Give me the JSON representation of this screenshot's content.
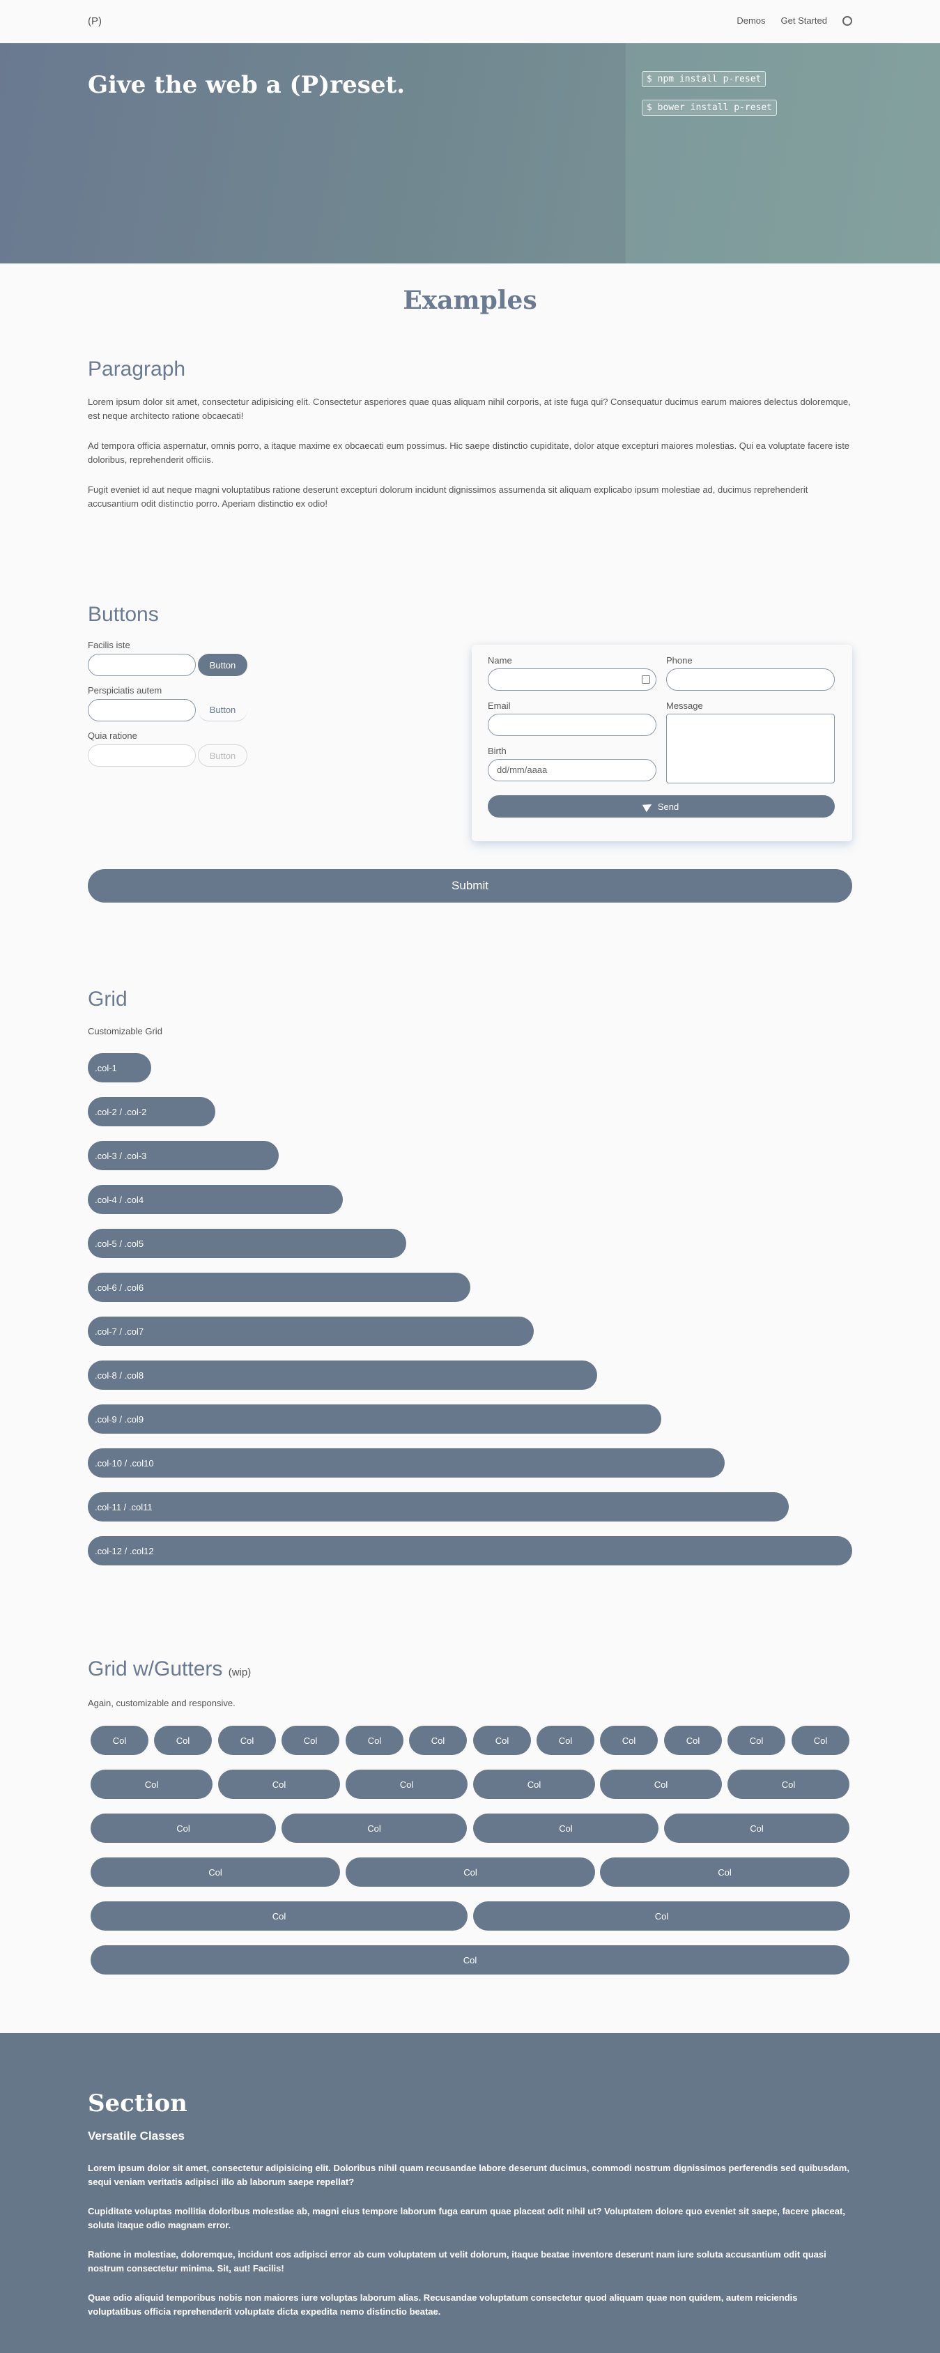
{
  "nav": {
    "logo": "(P)",
    "links": [
      "Demos",
      "Get Started"
    ],
    "github_icon": "github-icon"
  },
  "hero": {
    "title": "Give the web a (P)reset.",
    "commands": [
      "$ npm install p-reset",
      "$ bower install p-reset"
    ]
  },
  "examples_title": "Examples",
  "paragraph": {
    "heading": "Paragraph",
    "texts": [
      "Lorem ipsum dolor sit amet, consectetur adipisicing elit. Consectetur asperiores quae quas aliquam nihil corporis, at iste fuga qui? Consequatur ducimus earum maiores delectus doloremque, est neque architecto ratione obcaecati!",
      "Ad tempora officia aspernatur, omnis porro, a itaque maxime ex obcaecati eum possimus. Hic saepe distinctio cupiditate, dolor atque excepturi maiores molestias. Qui ea voluptate facere iste doloribus, reprehenderit officiis.",
      "Fugit eveniet id aut neque magni voluptatibus ratione deserunt excepturi dolorum incidunt dignissimos assumenda sit aliquam explicabo ipsum molestiae ad, ducimus reprehenderit accusantium odit distinctio porro. Aperiam distinctio ex odio!"
    ]
  },
  "buttons": {
    "heading": "Buttons",
    "rows": [
      {
        "label": "Facilis iste",
        "button": "Button"
      },
      {
        "label": "Perspiciatis autem",
        "button": "Button"
      },
      {
        "label": "Quia ratione",
        "button": "Button"
      }
    ],
    "form": {
      "name_label": "Name",
      "phone_label": "Phone",
      "email_label": "Email",
      "message_label": "Message",
      "birth_label": "Birth",
      "birth_placeholder": "dd/mm/aaaa",
      "send_label": "Send"
    },
    "submit_label": "Submit"
  },
  "grid": {
    "heading": "Grid",
    "subtitle": "Customizable Grid",
    "cols": [
      ".col-1",
      ".col-2 / .col-2",
      ".col-3 / .col-3",
      ".col-4 / .col4",
      ".col-5 / .col5",
      ".col-6 / .col6",
      ".col-7 / .col7",
      ".col-8 / .col8",
      ".col-9 / .col9",
      ".col-10 / .col10",
      ".col-11 / .col11",
      ".col-12 / .col12"
    ]
  },
  "gutters": {
    "heading": "Grid w/Gutters",
    "wip": "(wip)",
    "subtitle": "Again, customizable and responsive.",
    "col_label": "Col",
    "rows": [
      12,
      6,
      4,
      3,
      2,
      1
    ]
  },
  "section": {
    "title": "Section",
    "subtitle": "Versatile Classes",
    "texts": [
      "Lorem ipsum dolor sit amet, consectetur adipisicing elit. Doloribus nihil quam recusandae labore deserunt ducimus, commodi nostrum dignissimos perferendis sed quibusdam, sequi veniam veritatis adipisci illo ab laborum saepe repellat?",
      "Cupiditate voluptas mollitia doloribus molestiae ab, magni eius tempore laborum fuga earum quae placeat odit nihil ut? Voluptatem dolore quo eveniet sit saepe, facere placeat, soluta itaque odio magnam error.",
      "Ratione in molestiae, doloremque, incidunt eos adipisci error ab cum voluptatem ut velit dolorum, itaque beatae inventore deserunt nam iure soluta accusantium odit quasi nostrum consectetur minima. Sit, aut! Facilis!",
      "Quae odio aliquid temporibus nobis non maiores iure voluptas laborum alias. Recusandae voluptatum consectetur quod aliquam quae non quidem, autem reiciendis voluptatibus officia reprehenderit voluptate dicta expedita nemo distinctio beatae."
    ]
  },
  "colors": {
    "primary": "#68788c",
    "heading": "#6a7a90"
  }
}
